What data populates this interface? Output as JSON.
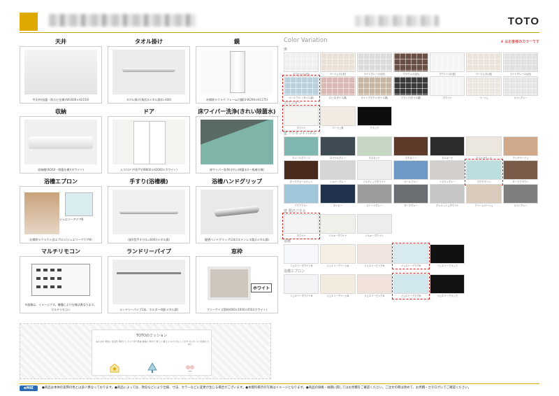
{
  "header": {
    "brand": "TOTO"
  },
  "products": [
    {
      "title": "天井",
      "caption": "平天井(抗菌・防カビ仕様)(W1600×H2150)"
    },
    {
      "title": "タオル掛け",
      "caption": "タオル掛け(角形)(メタル調)(L-400)"
    },
    {
      "title": "鏡",
      "caption": "お掃除ラクラク フレーム付鏡(S-W290×H1175)"
    },
    {
      "title": "収納",
      "caption": "収納棚(W260・除菌仕様)(ホワイト)"
    },
    {
      "title": "ドア",
      "caption": "入り口ドア(折戸)(W800×H2000×ホワイト)"
    },
    {
      "title": "床ワイパー洗浄(きれい除菌水)",
      "caption": "床ワイパー洗浄(きれい除菌水)(一般者仕様)"
    },
    {
      "title": "浴槽エプロン",
      "caption": "お掃除ラクラク入浴エプロン(ジュエリーアクアN)",
      "label": "ジュエリーアクアN"
    },
    {
      "title": "手すり(浴槽横)",
      "caption": "(縦)I型手すり(L=600)(メタル調)"
    },
    {
      "title": "浴槽ハンドグリップ",
      "caption": "握望ハンドグリップ(2本)(ステンレス製)(メタル調)"
    },
    {
      "title": "マルチリモコン",
      "caption": "マルチリモコン",
      "note": "※画像は、イメージです。機種により仕様は異なります。"
    },
    {
      "title": "ランドリーパイプ",
      "caption": "ランドリーパイプ1本、ホルダー4個(メタル調)"
    },
    {
      "title": "窓枠",
      "caption": "フリーサイズ窓枠(600×1000×450)(ホワイト)",
      "label": "ホワイト"
    }
  ],
  "mission": {
    "title": "TOTOのミッション",
    "cols": [
      "みんなの 文化に 生活を 豊かにしていく",
      "まだ見ぬ 快適に 向けて 新しい 暮らしへ",
      "いつでも しっかり のこれ 人と社会の ために"
    ]
  },
  "color_variation": {
    "title": "Color Variation",
    "note": "※ はお客様のカラーです",
    "sections": [
      {
        "label": "床",
        "rows": [
          [
            {
              "name": "ホワイト(1)(旧)",
              "color": "#efefef",
              "pattern": "tile"
            },
            {
              "name": "ベージュ(1)(旧)",
              "color": "#e9e1d5",
              "pattern": "tile"
            },
            {
              "name": "ライトグレー(1)(旧)",
              "color": "#dcdcdc",
              "pattern": "tile"
            },
            {
              "name": "ブラウン(1)(旧)",
              "color": "#6a4e42",
              "pattern": "tile"
            },
            {
              "name": "ホワイト(2)(旧)",
              "color": "#f4f4f4",
              "pattern": "tile"
            },
            {
              "name": "ベージュ(2)(旧)",
              "color": "#ece4da",
              "pattern": "tile"
            },
            {
              "name": "ライトグレー(2)(旧)",
              "color": "#e1e1e1",
              "pattern": "tile"
            }
          ],
          [
            {
              "name": "ペールブルー(タイル調)",
              "color": "#b9cfd9",
              "pattern": "tile",
              "selected": true
            },
            {
              "name": "ローズ(タイル調)",
              "color": "#d9b9b6",
              "pattern": "tile"
            },
            {
              "name": "ライトブラウン(タイル調)",
              "color": "#c9b6a1",
              "pattern": "tile"
            },
            {
              "name": "ブラック(タイル調)",
              "color": "#3a3a3a",
              "pattern": "tile"
            },
            {
              "name": "ホワイト",
              "color": "#f5f5f5",
              "pattern": "tile"
            },
            {
              "name": "ベージュ",
              "color": "#ece6de",
              "pattern": "tile"
            },
            {
              "name": "ライトグレー",
              "color": "#e4e4e4",
              "pattern": "tile"
            }
          ]
        ]
      },
      {
        "label": "カウンター",
        "rows": [
          [
            {
              "name": "ホワイト",
              "color": "#f6f4f0",
              "selected": true
            },
            {
              "name": "ベージュ系",
              "color": "#f1ebe2"
            },
            {
              "name": "ブラック",
              "color": "#0d0d0d"
            }
          ]
        ]
      },
      {
        "label": "壁 アクセントパネル",
        "rows": [
          [
            {
              "name": "ティールグリーン",
              "color": "#7fb6b0"
            },
            {
              "name": "ロイヤルグレー",
              "color": "#3e4b52"
            },
            {
              "name": "マスカット",
              "color": "#c6d8c4"
            },
            {
              "name": "マホガニー",
              "color": "#5d3a2a"
            },
            {
              "name": "マルキーナ",
              "color": "#2c2c2c"
            },
            {
              "name": "ホワイトウッド",
              "color": "#ece7de"
            },
            {
              "name": "ウッドベージュ",
              "color": "#cfa98a"
            }
          ],
          [
            {
              "name": "ダークウォールナット",
              "color": "#4a2a1c"
            },
            {
              "name": "シルバーグレー",
              "color": "#d6d6d6"
            },
            {
              "name": "ノルディックホワイト",
              "color": "#eeeeee"
            },
            {
              "name": "ペールブルー",
              "color": "#6e98c6"
            },
            {
              "name": "ミスティグレー",
              "color": "#d2cfcc"
            },
            {
              "name": "アクアマリン",
              "color": "#bcdede",
              "selected": true
            },
            {
              "name": "ダークブラウン",
              "color": "#7a5a48"
            }
          ],
          [
            {
              "name": "アクアブルー",
              "color": "#9fc6d9"
            },
            {
              "name": "ネイビー",
              "color": "#22344d"
            },
            {
              "name": "ストーングレー",
              "color": "#9c9c9c"
            },
            {
              "name": "ダークグレー",
              "color": "#6a6f74"
            },
            {
              "name": "グレイッシュホワイト",
              "color": "#c6c6c6"
            },
            {
              "name": "クリームベージュ",
              "color": "#d9cbbb"
            },
            {
              "name": "ライトグレー",
              "color": "#7e7e7e"
            }
          ]
        ]
      },
      {
        "label": "壁 周辺パネル",
        "rows": [
          [
            {
              "name": "ホワイト",
              "color": "#f4f4f4",
              "selected": true
            },
            {
              "name": "ミルキーホワイト",
              "color": "#f0efea"
            },
            {
              "name": "シルキーホワイト",
              "color": "#ededed"
            }
          ]
        ]
      },
      {
        "label": "浴槽",
        "rows": [
          [
            {
              "name": "ジュエリーホワイトN",
              "color": "#f6f8fb"
            },
            {
              "name": "ジュエリークリームN",
              "color": "#f5efe4"
            },
            {
              "name": "ジュエリーピンクN",
              "color": "#f2e5df"
            },
            {
              "name": "ジュエリーアクアN",
              "color": "#d7eaf0",
              "selected": true
            },
            {
              "name": "ジュエリーブラック",
              "color": "#111111"
            }
          ]
        ]
      },
      {
        "label": "浴槽エプロン",
        "rows": [
          [
            {
              "name": "ジュエリーホワイトN",
              "color": "#f4f4f6"
            },
            {
              "name": "ジュエリークリームN",
              "color": "#f3ecde"
            },
            {
              "name": "ジュエリーピンクN",
              "color": "#f0e1db"
            },
            {
              "name": "ジュエリーアクアN",
              "color": "#d2e8ef",
              "selected": true
            },
            {
              "name": "ジュエリーブラック",
              "color": "#121212"
            }
          ]
        ]
      }
    ]
  },
  "footer": {
    "logo": "eMIE",
    "text": "●商品は本体の実際の色とは多少異なっております。●商品によっては、改良などにより仕様、寸法、カラーなどに変更が生じる場合がございます。●本資料掲示の写真はイメージとなります。●商品の価格・納期に関してはお見積をご確認ください。ご注文の際は改めて、お見積・カタログにてご確認ください。"
  }
}
